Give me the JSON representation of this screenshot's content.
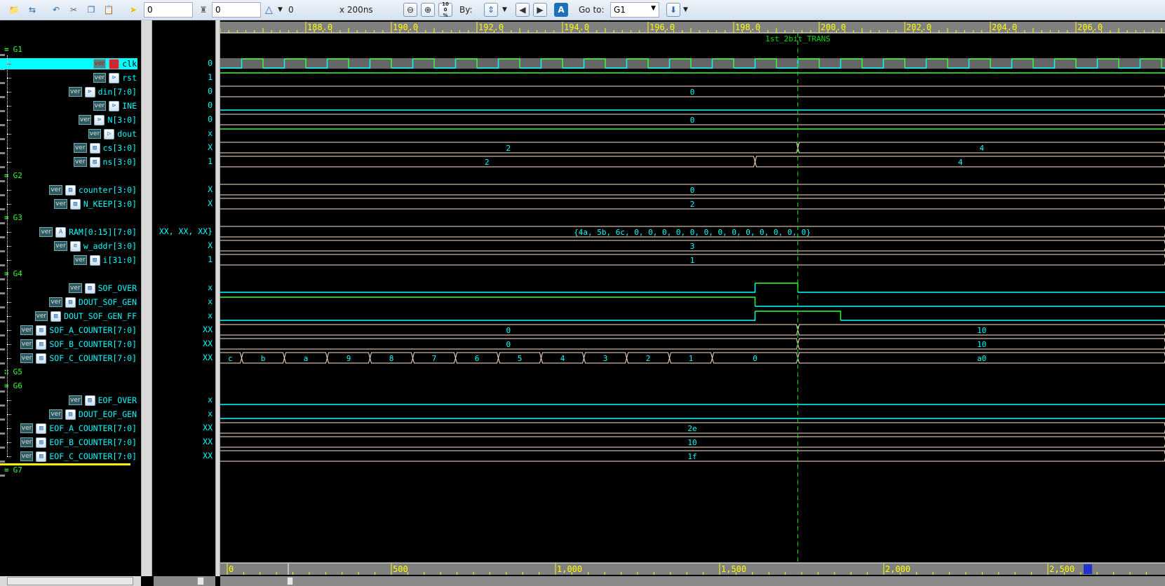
{
  "toolbar": {
    "icons": [
      "open-folder-icon",
      "restore-icon",
      "undo-icon",
      "cut-icon",
      "copy-icon",
      "paste-icon",
      "cursor-icon",
      "marker-icon",
      "zoom-out-icon",
      "zoom-in-icon",
      "zoom-fit-icon",
      "search-by-icon",
      "prev-icon",
      "next-icon",
      "auto-search-icon",
      "bookmark-icon"
    ],
    "cursor_time": "0",
    "marker_time": "0",
    "delta_value": "0",
    "scale": "x 200ns",
    "zoom100": "100 %",
    "by_label": "By:",
    "goto_label": "Go to:",
    "goto_value": "G1"
  },
  "colors": {
    "high": "#33ff33",
    "low": "#00ffff",
    "bus": "#ffe4c8",
    "marker": "#00dd00",
    "ruler_text": "#ffff00",
    "selected_row": "#00ffff"
  },
  "view": {
    "start": 186.0,
    "end": 208.0
  },
  "ruler": {
    "labels": [
      "188.0",
      "190.0",
      "192.0",
      "194.0",
      "196.0",
      "198.0",
      "200.0",
      "202.0",
      "204.0",
      "206.0"
    ],
    "values": [
      188,
      190,
      192,
      194,
      196,
      198,
      200,
      202,
      204,
      206
    ]
  },
  "overview_ruler": {
    "labels": [
      "0",
      "500",
      "1,000",
      "1,500",
      "2,000",
      "2,500"
    ],
    "values": [
      0,
      500,
      1000,
      1500,
      2000,
      2500
    ],
    "window_start": 186
  },
  "marker": {
    "name": "1st_2bit_TRANS",
    "time": 199.5
  },
  "rows": [
    {
      "group": "G1"
    },
    {
      "name": "clk",
      "value": "0",
      "icon": "input-port-icon",
      "selected": true,
      "wave": {
        "kind": "clock",
        "period": 1,
        "first_rise": 186.5
      }
    },
    {
      "name": "rst",
      "value": "1",
      "icon": "input-port-icon",
      "wave": {
        "kind": "bit",
        "changes": [
          [
            186,
            "1"
          ]
        ]
      }
    },
    {
      "name": "din[7:0]",
      "value": "0",
      "icon": "input-port-icon",
      "wave": {
        "kind": "bus",
        "changes": [
          [
            186,
            "0"
          ]
        ]
      }
    },
    {
      "name": "INE",
      "value": "0",
      "icon": "input-port-icon",
      "wave": {
        "kind": "bit",
        "changes": [
          [
            186,
            "0"
          ]
        ]
      }
    },
    {
      "name": "N[3:0]",
      "value": "0",
      "icon": "input-port-icon",
      "wave": {
        "kind": "bus",
        "changes": [
          [
            186,
            "0"
          ]
        ]
      }
    },
    {
      "name": "dout",
      "value": "x",
      "icon": "output-port-icon",
      "wave": {
        "kind": "bit",
        "changes": [
          [
            186,
            "1"
          ]
        ]
      }
    },
    {
      "name": "cs[3:0]",
      "value": "X",
      "icon": "register-icon",
      "wave": {
        "kind": "bus",
        "changes": [
          [
            186,
            "2"
          ],
          [
            199.5,
            "4"
          ]
        ]
      }
    },
    {
      "name": "ns[3:0]",
      "value": "1",
      "icon": "register-icon",
      "wave": {
        "kind": "bus",
        "changes": [
          [
            186,
            "2"
          ],
          [
            198.5,
            "4"
          ]
        ]
      }
    },
    {
      "group": "G2"
    },
    {
      "name": "counter[3:0]",
      "value": "X",
      "icon": "register-icon",
      "wave": {
        "kind": "bus",
        "changes": [
          [
            186,
            "0"
          ]
        ]
      }
    },
    {
      "name": "N_KEEP[3:0]",
      "value": "X",
      "icon": "register-icon",
      "wave": {
        "kind": "bus",
        "changes": [
          [
            186,
            "2"
          ]
        ]
      }
    },
    {
      "group": "G3"
    },
    {
      "name": "RAM[0:15][7:0]",
      "value": "XX, XX, XX}",
      "icon": "memory-icon",
      "wave": {
        "kind": "bus",
        "changes": [
          [
            186,
            "{4a, 5b, 6c, 0, 0, 0, 0, 0, 0, 0, 0, 0, 0, 0, 0, 0}"
          ]
        ]
      }
    },
    {
      "name": "w_addr[3:0]",
      "value": "X",
      "icon": "net-icon",
      "wave": {
        "kind": "bus",
        "changes": [
          [
            186,
            "3"
          ]
        ]
      }
    },
    {
      "name": "i[31:0]",
      "value": "1",
      "icon": "register-icon",
      "wave": {
        "kind": "bus",
        "changes": [
          [
            186,
            "1"
          ]
        ]
      }
    },
    {
      "group": "G4"
    },
    {
      "name": "SOF_OVER",
      "value": "x",
      "icon": "register-icon",
      "wave": {
        "kind": "bit",
        "changes": [
          [
            186,
            "0"
          ],
          [
            198.5,
            "1"
          ],
          [
            199.5,
            "0"
          ]
        ]
      }
    },
    {
      "name": "DOUT_SOF_GEN",
      "value": "x",
      "icon": "register-icon",
      "wave": {
        "kind": "bit",
        "changes": [
          [
            186,
            "1"
          ],
          [
            198.5,
            "0"
          ]
        ]
      }
    },
    {
      "name": "DOUT_SOF_GEN_FF",
      "value": "x",
      "icon": "register-icon",
      "wave": {
        "kind": "bit",
        "changes": [
          [
            186,
            "0"
          ],
          [
            198.5,
            "1"
          ],
          [
            200.5,
            "0"
          ]
        ]
      }
    },
    {
      "name": "SOF_A_COUNTER[7:0]",
      "value": "XX",
      "icon": "register-icon",
      "wave": {
        "kind": "bus",
        "changes": [
          [
            186,
            "0"
          ],
          [
            199.5,
            "10"
          ]
        ]
      }
    },
    {
      "name": "SOF_B_COUNTER[7:0]",
      "value": "XX",
      "icon": "register-icon",
      "wave": {
        "kind": "bus",
        "changes": [
          [
            186,
            "0"
          ],
          [
            199.5,
            "10"
          ]
        ]
      }
    },
    {
      "name": "SOF_C_COUNTER[7:0]",
      "value": "XX",
      "icon": "register-icon",
      "wave": {
        "kind": "bus",
        "changes": [
          [
            186,
            "c"
          ],
          [
            186.5,
            "b"
          ],
          [
            187.5,
            "a"
          ],
          [
            188.5,
            "9"
          ],
          [
            189.5,
            "8"
          ],
          [
            190.5,
            "7"
          ],
          [
            191.5,
            "6"
          ],
          [
            192.5,
            "5"
          ],
          [
            193.5,
            "4"
          ],
          [
            194.5,
            "3"
          ],
          [
            195.5,
            "2"
          ],
          [
            196.5,
            "1"
          ],
          [
            197.5,
            "0"
          ],
          [
            199.5,
            "a0"
          ]
        ]
      }
    },
    {
      "group": "G5",
      "collapsed": true
    },
    {
      "group": "G6"
    },
    {
      "name": "EOF_OVER",
      "value": "x",
      "icon": "register-icon",
      "wave": {
        "kind": "bit",
        "changes": [
          [
            186,
            "0"
          ]
        ]
      }
    },
    {
      "name": "DOUT_EOF_GEN",
      "value": "x",
      "icon": "register-icon",
      "wave": {
        "kind": "bit",
        "changes": [
          [
            186,
            "0"
          ]
        ]
      }
    },
    {
      "name": "EOF_A_COUNTER[7:0]",
      "value": "XX",
      "icon": "register-icon",
      "wave": {
        "kind": "bus",
        "changes": [
          [
            186,
            "2e"
          ]
        ]
      }
    },
    {
      "name": "EOF_B_COUNTER[7:0]",
      "value": "XX",
      "icon": "register-icon",
      "wave": {
        "kind": "bus",
        "changes": [
          [
            186,
            "10"
          ]
        ]
      }
    },
    {
      "name": "EOF_C_COUNTER[7:0]",
      "value": "XX",
      "icon": "register-icon",
      "wave": {
        "kind": "bus",
        "changes": [
          [
            186,
            "1f"
          ]
        ]
      }
    },
    {
      "group": "G7"
    }
  ],
  "ver_label": "ver"
}
